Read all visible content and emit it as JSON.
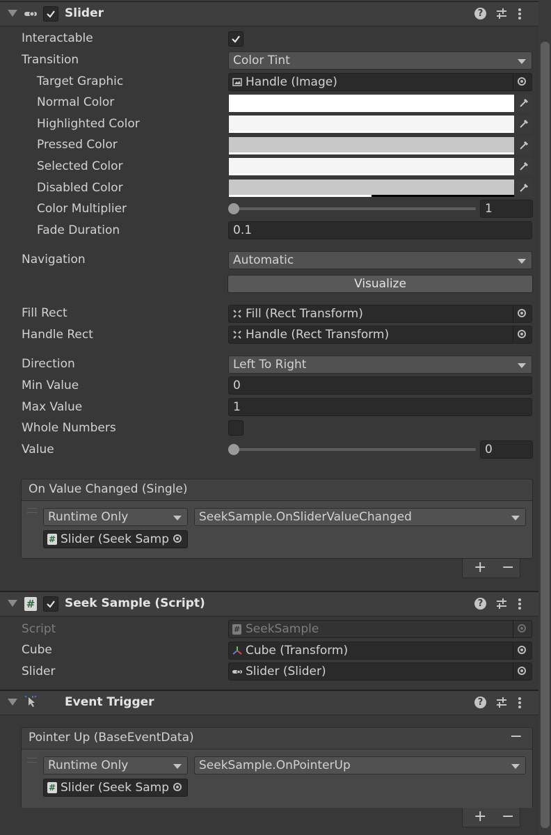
{
  "slider_component": {
    "title": "Slider",
    "interactable_label": "Interactable",
    "interactable_checked": true,
    "transition_label": "Transition",
    "transition_value": "Color Tint",
    "target_graphic_label": "Target Graphic",
    "target_graphic_value": "Handle (Image)",
    "normal_color_label": "Normal Color",
    "normal_color": "#ffffff",
    "highlighted_color_label": "Highlighted Color",
    "highlighted_color": "#f5f5f5",
    "pressed_color_label": "Pressed Color",
    "pressed_color": "#c8c8c8",
    "selected_color_label": "Selected Color",
    "selected_color": "#f5f5f5",
    "disabled_color_label": "Disabled Color",
    "disabled_color": "#c8c8c8",
    "color_multiplier_label": "Color Multiplier",
    "color_multiplier_value": "1",
    "fade_duration_label": "Fade Duration",
    "fade_duration_value": "0.1",
    "navigation_label": "Navigation",
    "navigation_value": "Automatic",
    "visualize_label": "Visualize",
    "fill_rect_label": "Fill Rect",
    "fill_rect_value": "Fill (Rect Transform)",
    "handle_rect_label": "Handle Rect",
    "handle_rect_value": "Handle (Rect Transform)",
    "direction_label": "Direction",
    "direction_value": "Left To Right",
    "min_value_label": "Min Value",
    "min_value": "0",
    "max_value_label": "Max Value",
    "max_value": "1",
    "whole_numbers_label": "Whole Numbers",
    "whole_numbers_checked": false,
    "value_label": "Value",
    "value": "0",
    "event_header": "On Value Changed (Single)",
    "event_runtime": "Runtime Only",
    "event_function": "SeekSample.OnSliderValueChanged",
    "event_object": "Slider (Seek Samp"
  },
  "seek_sample_component": {
    "title": "Seek Sample (Script)",
    "script_label": "Script",
    "script_value": "SeekSample",
    "cube_label": "Cube",
    "cube_value": "Cube (Transform)",
    "slider_label": "Slider",
    "slider_value": "Slider (Slider)"
  },
  "event_trigger_component": {
    "title": "Event Trigger",
    "event_header": "Pointer Up (BaseEventData)",
    "event_runtime": "Runtime Only",
    "event_function": "SeekSample.OnPointerUp",
    "event_object": "Slider (Seek Samp"
  },
  "common": {
    "plus": "+",
    "minus": "−",
    "help": "?"
  }
}
